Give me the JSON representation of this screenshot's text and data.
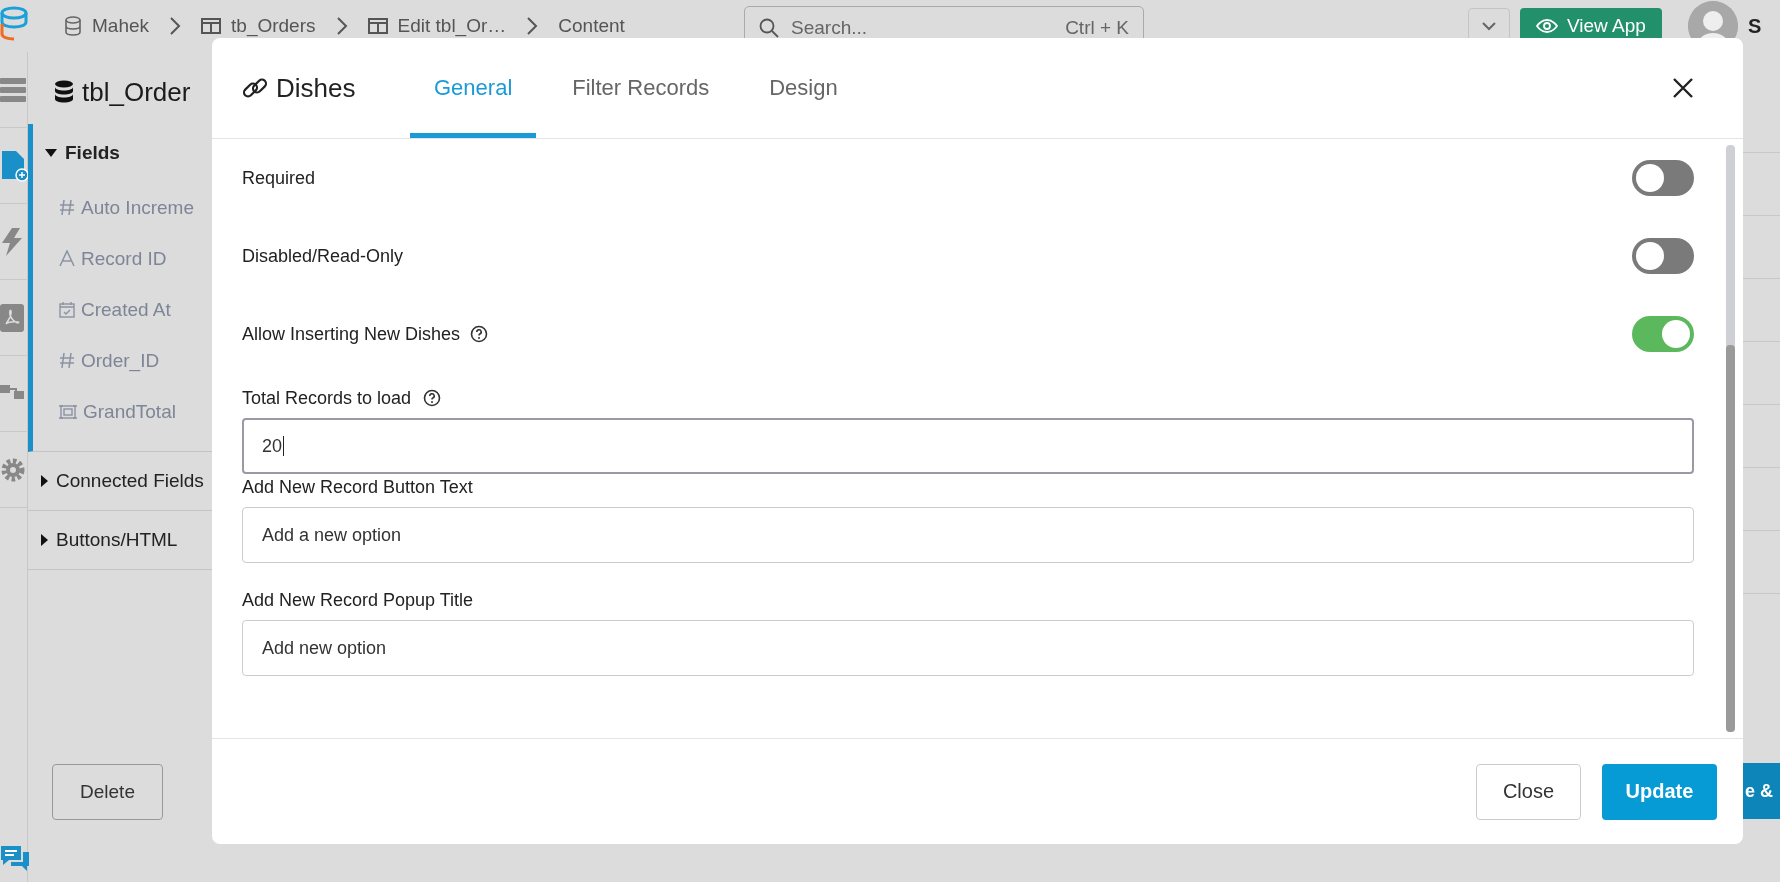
{
  "breadcrumbs": [
    {
      "label": "Mahek",
      "kind": "database"
    },
    {
      "label": "tb_Orders",
      "kind": "table"
    },
    {
      "label": "Edit tbl_Or…",
      "kind": "table"
    },
    {
      "label": "Content",
      "kind": "plain"
    }
  ],
  "search": {
    "placeholder": "Search...",
    "shortcut": "Ctrl + K"
  },
  "view_app": "View App",
  "user_initial": "S",
  "sidebar": {
    "title": "tbl_Order",
    "sections": [
      {
        "label": "Fields",
        "expanded": true,
        "items": [
          {
            "label": "Auto Increme",
            "kind": "number"
          },
          {
            "label": "Record ID",
            "kind": "text"
          },
          {
            "label": "Created At",
            "kind": "date"
          },
          {
            "label": "Order_ID",
            "kind": "number"
          },
          {
            "label": "GrandTotal",
            "kind": "formula"
          }
        ]
      },
      {
        "label": "Connected Fields",
        "expanded": false
      },
      {
        "label": "Buttons/HTML",
        "expanded": false
      }
    ]
  },
  "delete_button": "Delete",
  "behind_button": "e &",
  "modal": {
    "title": "Dishes",
    "tabs": [
      {
        "label": "General",
        "selected": true
      },
      {
        "label": "Filter Records",
        "selected": false
      },
      {
        "label": "Design",
        "selected": false
      }
    ],
    "toggles": [
      {
        "label": "Required",
        "on": false,
        "help": false
      },
      {
        "label": "Disabled/Read-Only",
        "on": false,
        "help": false
      },
      {
        "label": "Allow Inserting New Dishes",
        "on": true,
        "help": true
      }
    ],
    "fields": [
      {
        "label": "Total Records to load",
        "help": true,
        "value": "20",
        "focused": true
      },
      {
        "label": "Add New Record Button Text",
        "help": false,
        "value": "Add a new option",
        "focused": false
      },
      {
        "label": "Add New Record Popup Title",
        "help": false,
        "value": "Add new option",
        "focused": false
      }
    ],
    "buttons": [
      {
        "label": "Close",
        "kind": "secondary"
      },
      {
        "label": "Update",
        "kind": "primary"
      }
    ]
  }
}
